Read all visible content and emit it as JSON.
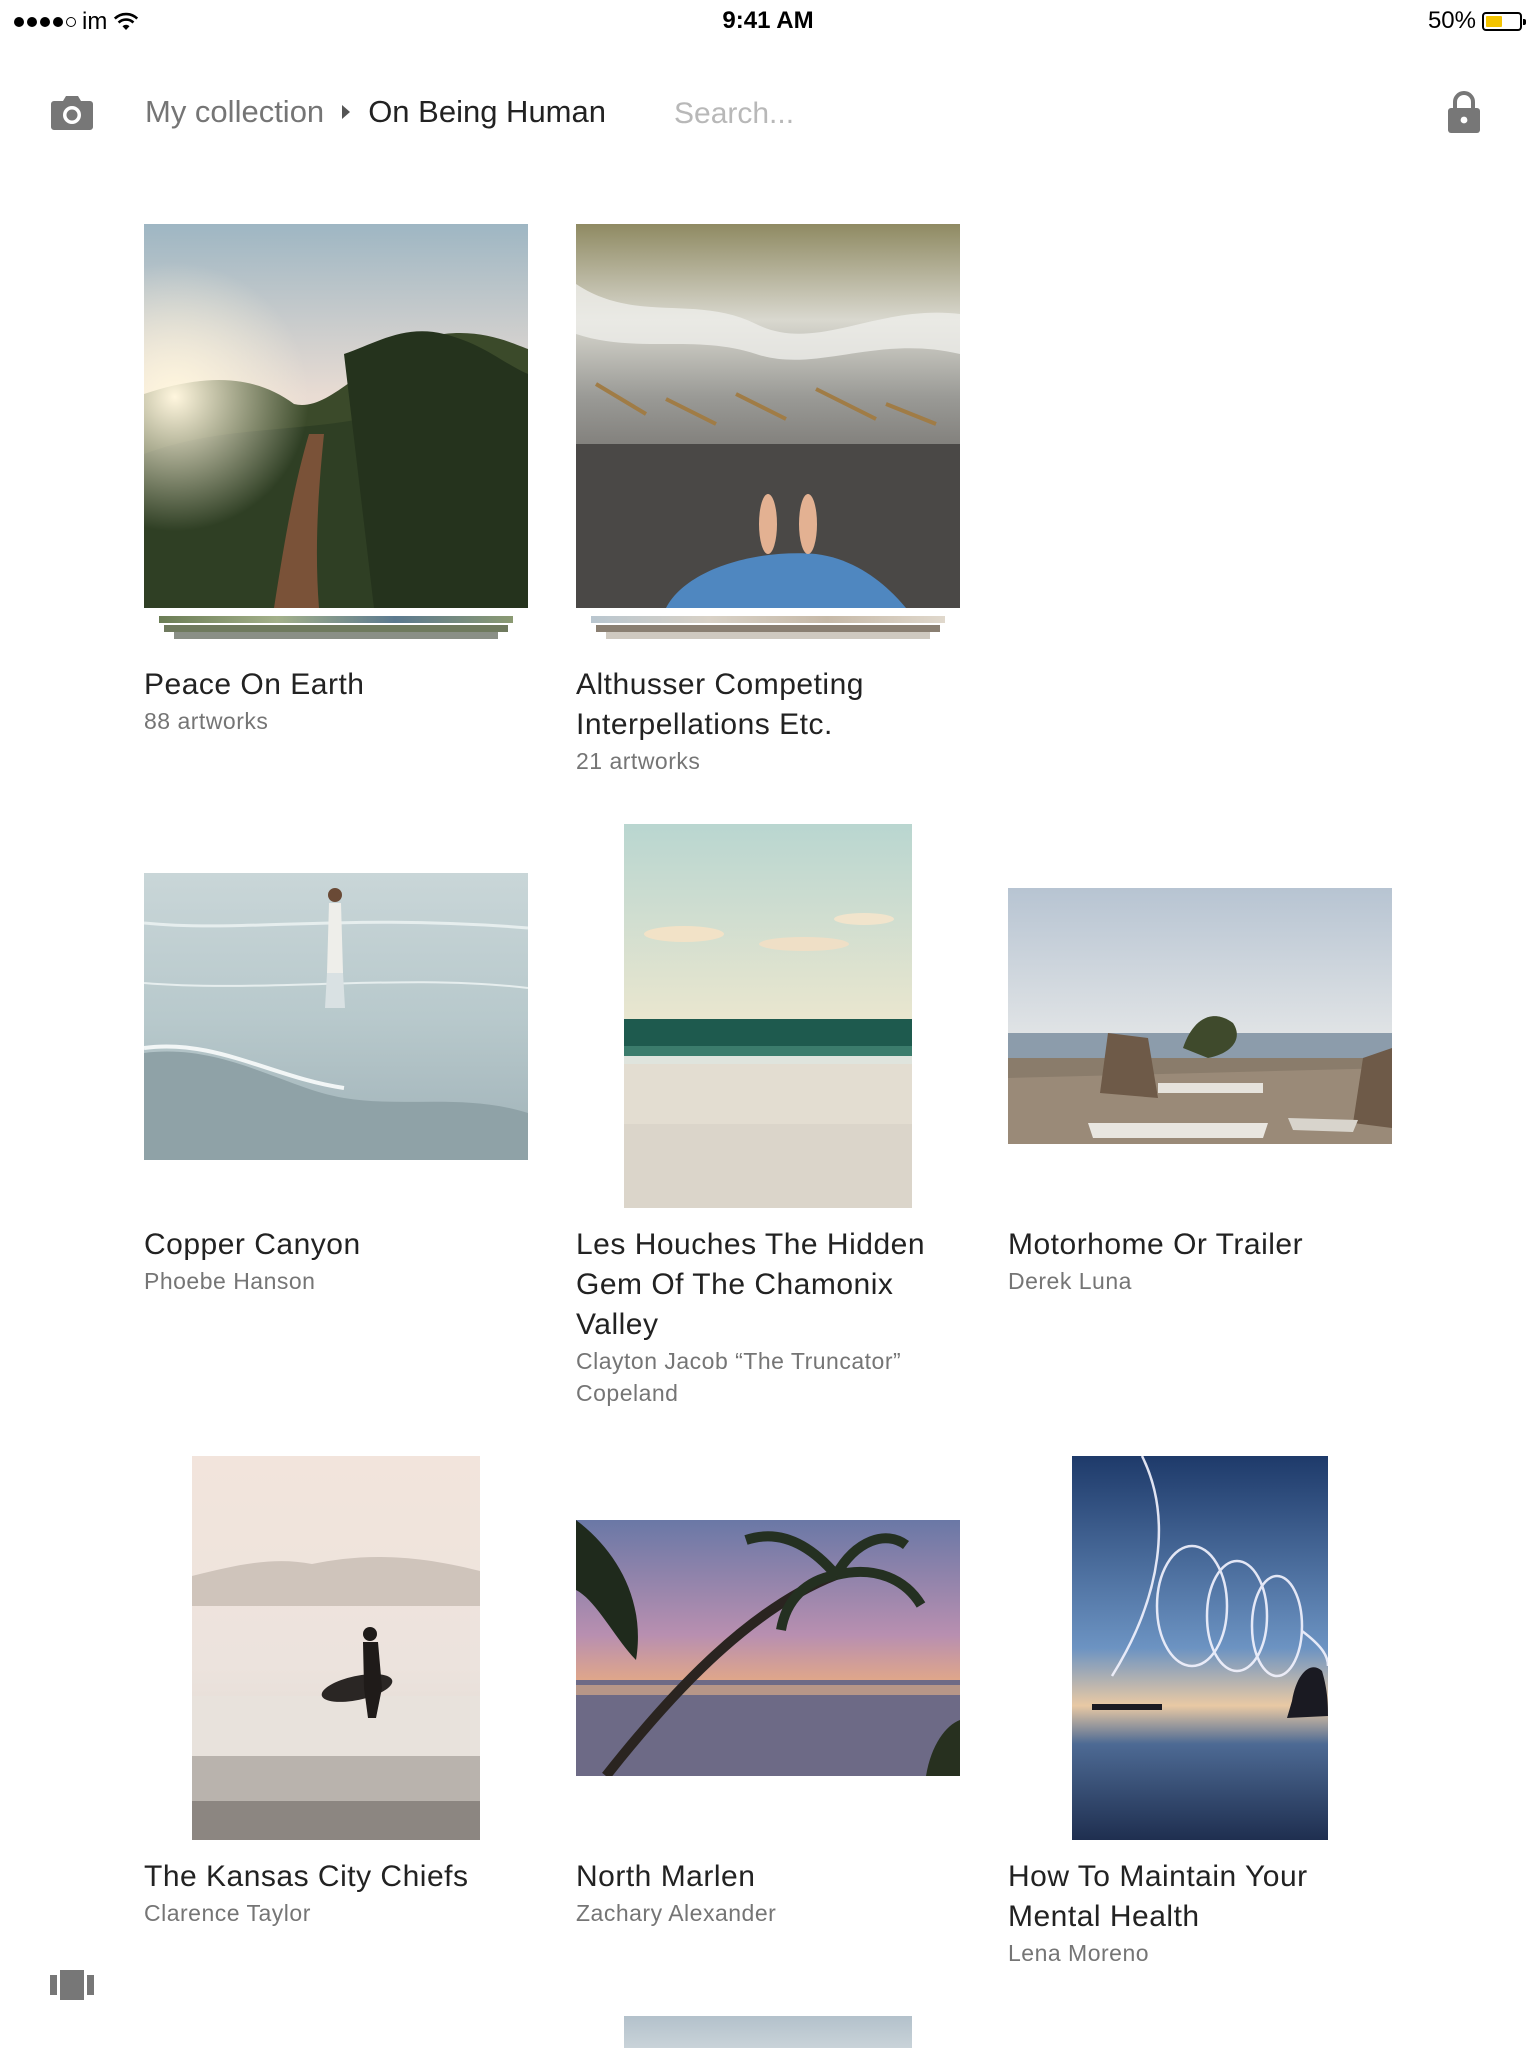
{
  "status_bar": {
    "carrier": "im",
    "time": "9:41 AM",
    "battery": "50%",
    "battery_level": 0.5
  },
  "header": {
    "breadcrumb_root": "My collection",
    "breadcrumb_current": "On Being Human",
    "search_placeholder": "Search..."
  },
  "sets": [
    {
      "title": "Peace On Earth",
      "subtitle": "88 artworks"
    },
    {
      "title": "Althusser Competing Interpellations Etc.",
      "subtitle": "21 artworks"
    }
  ],
  "artworks": [
    {
      "title": "Copper Canyon",
      "artist": "Phoebe Hanson"
    },
    {
      "title": "Les Houches The Hidden Gem Of The Chamonix Valley",
      "artist": "Clayton Jacob “The Truncator” Copeland"
    },
    {
      "title": "Motorhome Or Trailer",
      "artist": "Derek Luna"
    },
    {
      "title": "The Kansas City Chiefs",
      "artist": "Clarence Taylor"
    },
    {
      "title": "North Marlen",
      "artist": "Zachary Alexander"
    },
    {
      "title": "How To Maintain Your Mental Health",
      "artist": "Lena Moreno"
    }
  ],
  "icons": {
    "camera": "camera-icon",
    "lock": "lock-icon",
    "carousel": "carousel-icon",
    "wifi": "wifi-icon",
    "battery": "battery-icon"
  }
}
